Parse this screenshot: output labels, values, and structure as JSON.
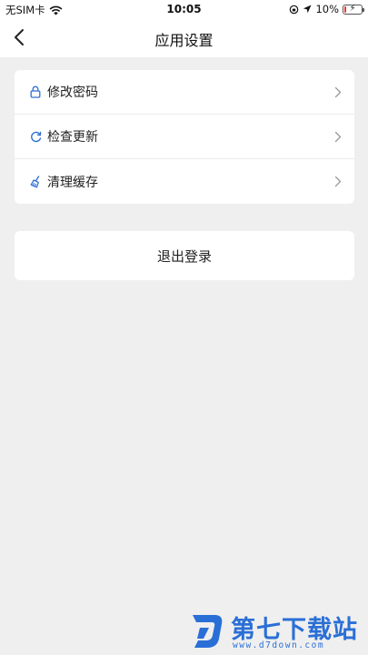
{
  "status_bar": {
    "carrier": "无SIM卡",
    "time": "10:05",
    "battery_percent": "10%",
    "battery_level": 0.1,
    "icons": [
      "wifi-icon",
      "rotation-lock-icon",
      "location-arrow-icon",
      "battery-icon"
    ]
  },
  "nav": {
    "title": "应用设置",
    "back_icon": "back-chevron-icon"
  },
  "settings": {
    "items": [
      {
        "label": "修改密码",
        "icon": "lock-icon"
      },
      {
        "label": "检查更新",
        "icon": "refresh-icon"
      },
      {
        "label": "清理缓存",
        "icon": "broom-icon"
      }
    ]
  },
  "logout": {
    "label": "退出登录"
  },
  "watermark": {
    "brand": "第七下载站",
    "url": "www.d7down.com"
  },
  "colors": {
    "accent": "#2f6fd6",
    "background": "#efefef",
    "watermark": "#2a6fd6"
  }
}
